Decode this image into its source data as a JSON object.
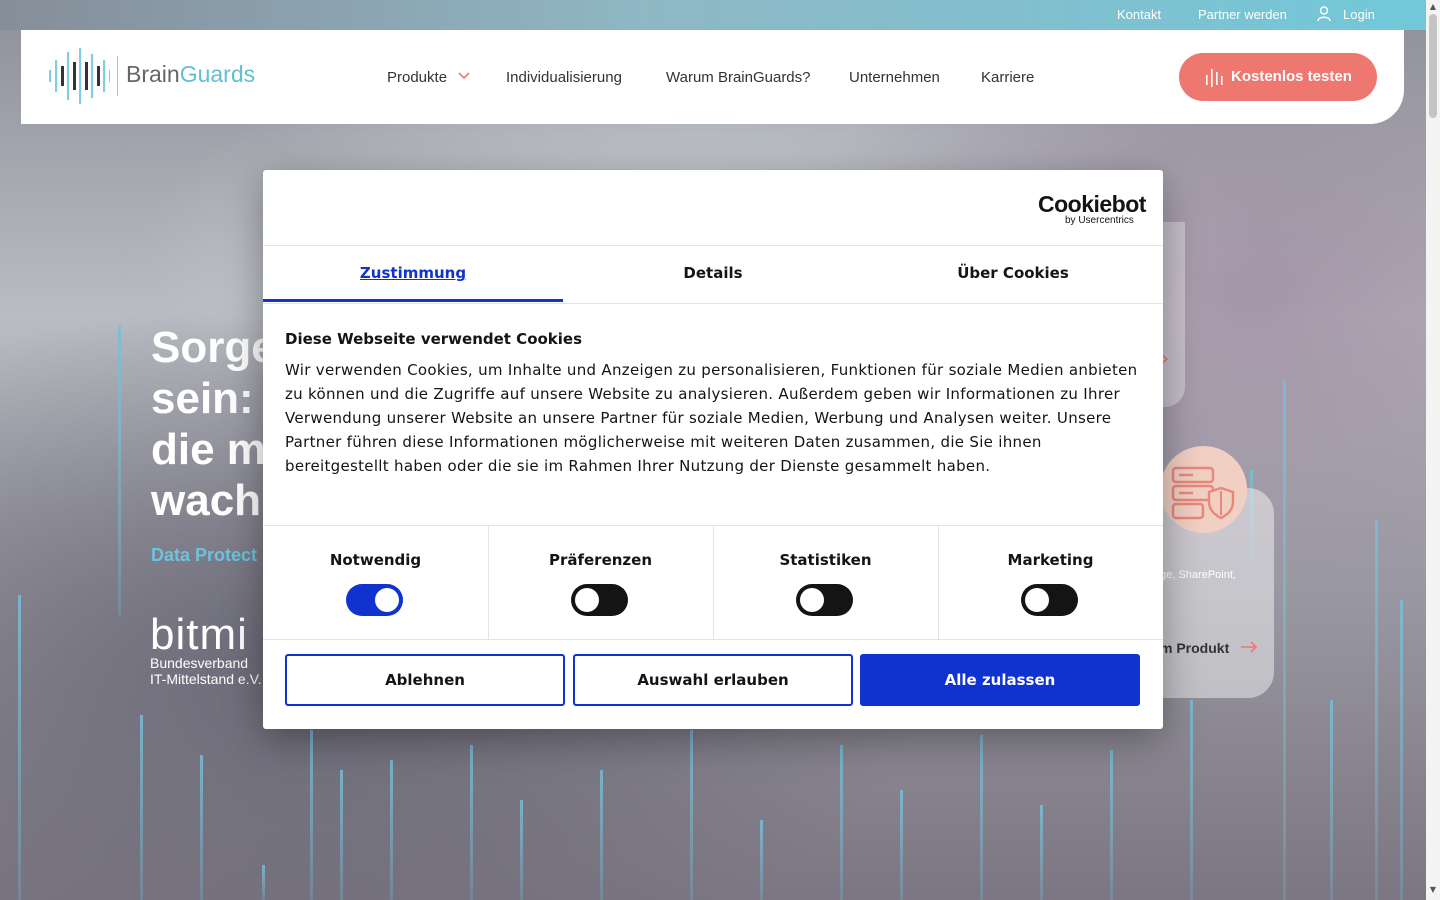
{
  "topbar": {
    "links": [
      "Kontakt",
      "Partner werden",
      "Login"
    ]
  },
  "header": {
    "logo_brain": "Brain",
    "logo_guards": "Guards",
    "nav": [
      "Produkte",
      "Individualisierung",
      "Warum BrainGuards?",
      "Unternehmen",
      "Karriere"
    ],
    "cta_label": "Kostenlos testen"
  },
  "hero": {
    "title_lines": [
      "Sorge",
      "sein: B",
      "die m",
      "wachs"
    ],
    "subtitle": "Data Protect",
    "bitmi_mark": "bitmi",
    "bitmi_line1": "Bundesverband",
    "bitmi_line2": "IT-Mittelstand e.V."
  },
  "cards": {
    "text_fragment": "nge, SharePoint,",
    "link_label": "m Produkt"
  },
  "dialog": {
    "brand_name": "Cookiebot",
    "brand_sub": "by Usercentrics",
    "tabs": [
      "Zustimmung",
      "Details",
      "Über Cookies"
    ],
    "active_tab": "Zustimmung",
    "title": "Diese Webseite verwendet Cookies",
    "body": "Wir verwenden Cookies, um Inhalte und Anzeigen zu personalisieren, Funktionen für soziale Medien anbieten zu können und die Zugriffe auf unsere Website zu analysieren. Außerdem geben wir Informationen zu Ihrer Verwendung unserer Website an unsere Partner für soziale Medien, Werbung und Analysen weiter. Unsere Partner führen diese Informationen möglicherweise mit weiteren Daten zusammen, die Sie ihnen bereitgestellt haben oder die sie im Rahmen Ihrer Nutzung der Dienste gesammelt haben.",
    "toggles": [
      {
        "label": "Notwendig",
        "on": true
      },
      {
        "label": "Präferenzen",
        "on": false
      },
      {
        "label": "Statistiken",
        "on": false
      },
      {
        "label": "Marketing",
        "on": false
      }
    ],
    "buttons": {
      "reject": "Ablehnen",
      "allow_selection": "Auswahl erlauben",
      "allow_all": "Alle zulassen"
    }
  },
  "colors": {
    "accent_blue": "#1032cf",
    "cta_coral": "#ee7770",
    "brand_teal": "#5fbfd5"
  }
}
